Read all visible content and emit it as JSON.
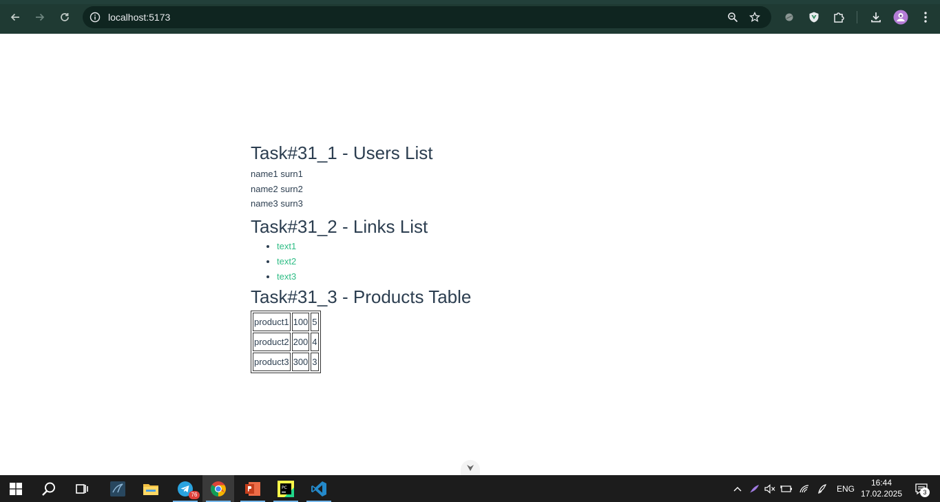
{
  "browser": {
    "url": "localhost:5173"
  },
  "page": {
    "users_section": {
      "title": "Task#31_1 - Users List",
      "users": [
        "name1 surn1",
        "name2 surn2",
        "name3 surn3"
      ]
    },
    "links_section": {
      "title": "Task#31_2 - Links List",
      "links": [
        "text1",
        "text2",
        "text3"
      ]
    },
    "products_section": {
      "title": "Task#31_3 - Products Table",
      "rows": [
        [
          "product1",
          "100",
          "5"
        ],
        [
          "product2",
          "200",
          "4"
        ],
        [
          "product3",
          "300",
          "3"
        ]
      ]
    }
  },
  "taskbar": {
    "telegram_badge": "76",
    "language": "ENG",
    "time": "16:44",
    "date": "17.02.2025",
    "notifications_count": "3"
  },
  "colors": {
    "chrome_bg": "#1f3a33",
    "omnibox_bg": "#0f2520",
    "heading": "#2c3e50",
    "link": "#2ebd85",
    "taskbar_bg": "#1c1c1c"
  },
  "icons": [
    "back-icon",
    "forward-icon",
    "reload-icon",
    "info-icon",
    "zoom-icon",
    "star-icon",
    "extension-icon",
    "shield-icon",
    "puzzle-icon",
    "download-icon",
    "profile-avatar",
    "menu-icon",
    "windows-start-icon",
    "search-icon",
    "task-view-icon",
    "mysql-icon",
    "file-explorer-icon",
    "telegram-icon",
    "chrome-icon",
    "powerpoint-icon",
    "pycharm-icon",
    "vscode-icon"
  ]
}
